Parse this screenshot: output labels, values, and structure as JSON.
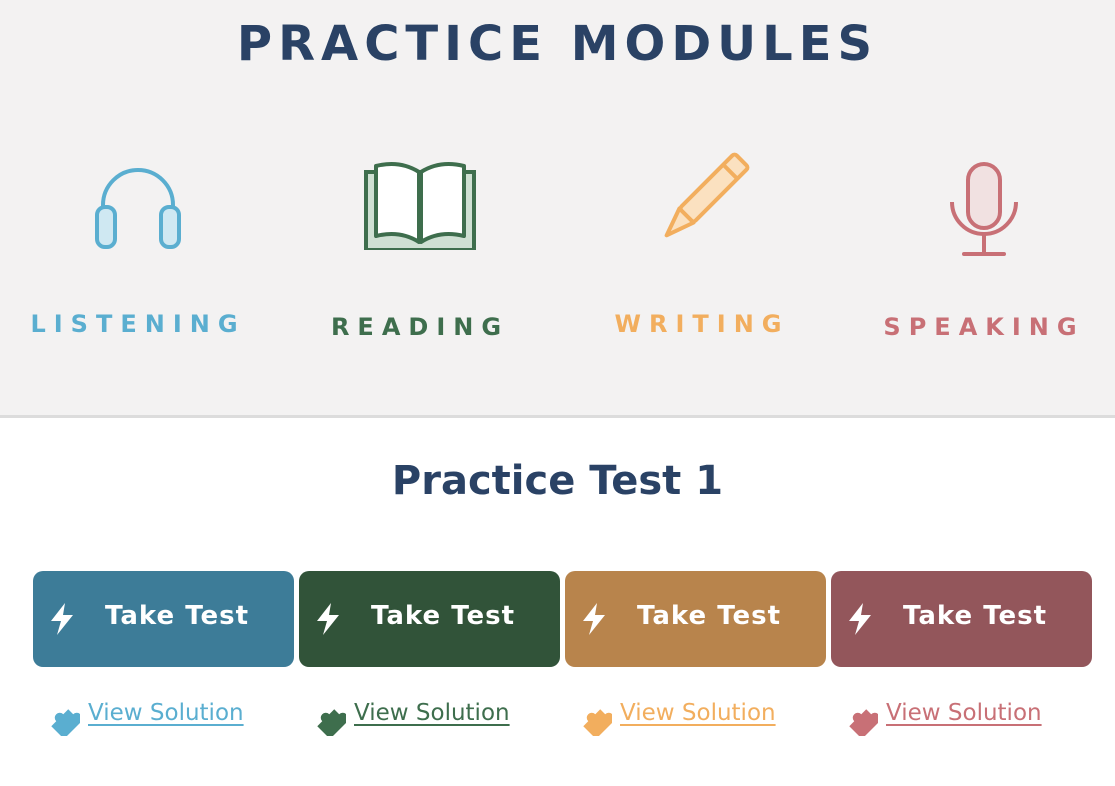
{
  "header": {
    "title": "PRACTICE MODULES"
  },
  "modules": [
    {
      "label": "LISTENING",
      "icon": "headphones-icon",
      "color": "#5aaed0"
    },
    {
      "label": "READING",
      "icon": "book-icon",
      "color": "#3e6e4d"
    },
    {
      "label": "WRITING",
      "icon": "pencil-icon",
      "color": "#f2ae5e"
    },
    {
      "label": "SPEAKING",
      "icon": "microphone-icon",
      "color": "#c87076"
    }
  ],
  "test": {
    "title": "Practice Test 1",
    "buttons": [
      {
        "label": "Take Test",
        "icon": "lightning-icon",
        "color": "#3d7c98"
      },
      {
        "label": "Take Test",
        "icon": "lightning-icon",
        "color": "#315339"
      },
      {
        "label": "Take Test",
        "icon": "lightning-icon",
        "color": "#b8844c"
      },
      {
        "label": "Take Test",
        "icon": "lightning-icon",
        "color": "#93565b"
      }
    ],
    "solutions": [
      {
        "label": "View Solution",
        "icon": "puzzle-icon",
        "color": "#5aaed0"
      },
      {
        "label": "View Solution",
        "icon": "puzzle-icon",
        "color": "#3e6e4d"
      },
      {
        "label": "View Solution",
        "icon": "puzzle-icon",
        "color": "#f2ae5e"
      },
      {
        "label": "View Solution",
        "icon": "puzzle-icon",
        "color": "#c87076"
      }
    ]
  }
}
